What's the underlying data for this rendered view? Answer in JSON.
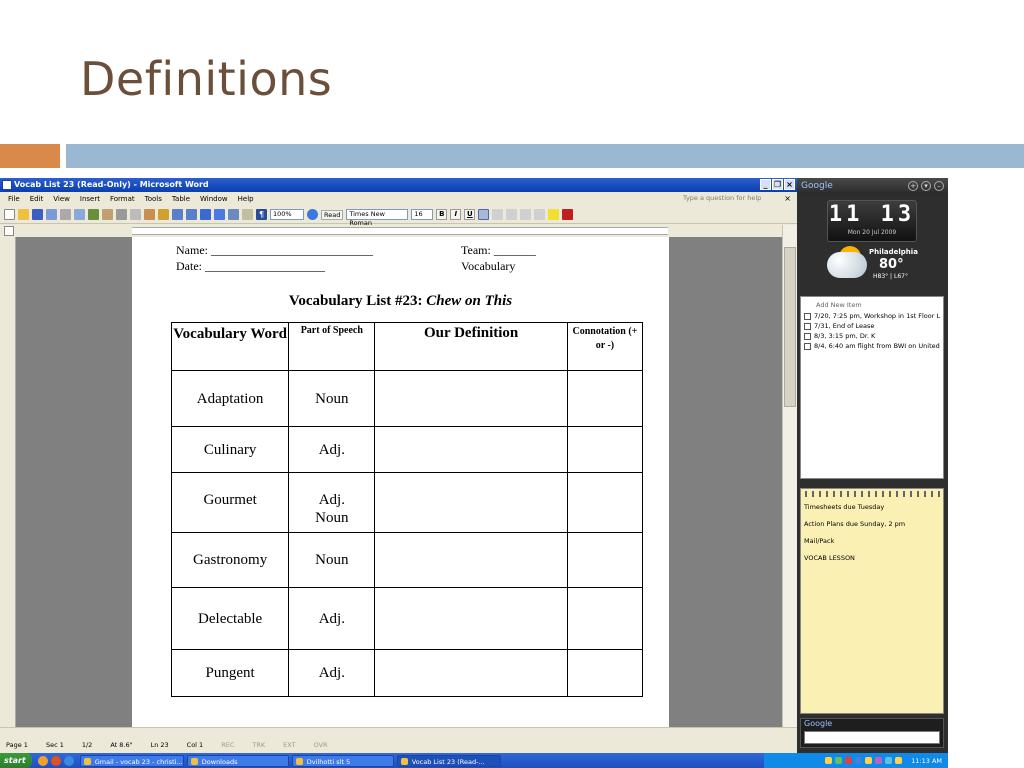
{
  "slide": {
    "title": "Definitions",
    "colors": {
      "title": "#6b4f3a",
      "accent_orange": "#d98a4a",
      "accent_blue": "#9bb8d3"
    }
  },
  "word": {
    "window_title": "Vocab List 23 (Read-Only) - Microsoft Word",
    "menu": [
      "File",
      "Edit",
      "View",
      "Insert",
      "Format",
      "Tools",
      "Table",
      "Window",
      "Help"
    ],
    "help_placeholder": "Type a question for help",
    "toolbar": {
      "zoom": "100%",
      "read_label": "Read",
      "font": "Times New Roman",
      "font_size": "16",
      "bold": "B",
      "italic": "I",
      "underline": "U"
    },
    "status": {
      "page": "Page 1",
      "sec": "Sec 1",
      "pages": "1/2",
      "at": "At 8.6\"",
      "ln": "Ln 23",
      "col": "Col 1",
      "rec": "REC",
      "trk": "TRK",
      "ext": "EXT",
      "ovr": "OVR"
    }
  },
  "document": {
    "name_line": "Name: ___________________________",
    "team_line": "Team: _______",
    "date_line": "Date: ____________________",
    "vocab_line": "Vocabulary",
    "title_prefix": "Vocabulary List #23:",
    "title_italic": "Chew on This",
    "columns": {
      "word": "Vocabulary Word",
      "pos": "Part of Speech",
      "definition": "Our Definition",
      "connotation": "Connotation (+ or -)"
    },
    "rows": [
      {
        "word": "Adaptation",
        "pos": "Noun"
      },
      {
        "word": "Culinary",
        "pos": "Adj."
      },
      {
        "word": "Gourmet",
        "pos": "Adj. Noun"
      },
      {
        "word": "Gastronomy",
        "pos": "Noun"
      },
      {
        "word": "Delectable",
        "pos": "Adj."
      },
      {
        "word": "Pungent",
        "pos": "Adj."
      }
    ]
  },
  "sidebar": {
    "header": "Google",
    "clock_time": "11 13",
    "clock_date": "Mon 20 Jul 2009",
    "weather": {
      "city": "Philadelphia",
      "temp": "80°",
      "hilo": "H83° | L67°"
    },
    "todo_add": "Add New Item",
    "todo_items": [
      "7/20, 7:25 pm, Workshop in 1st Floor L...",
      "7/31, End of Lease",
      "8/3, 3:15 pm, Dr. K",
      "8/4, 6:40 am flight from BWI on United"
    ],
    "notes": [
      "Timesheets due Tuesday",
      "Action Plans due Sunday, 2 pm",
      "Mail/Pack",
      "VOCAB LESSON"
    ],
    "search_label": "Google"
  },
  "taskbar": {
    "start": "start",
    "tasks": [
      "Gmail - vocab 23 - christi...",
      "Downloads",
      "Dvilhotti slt 5",
      "Vocab List 23 (Read-..."
    ],
    "clock": "11:13 AM"
  }
}
